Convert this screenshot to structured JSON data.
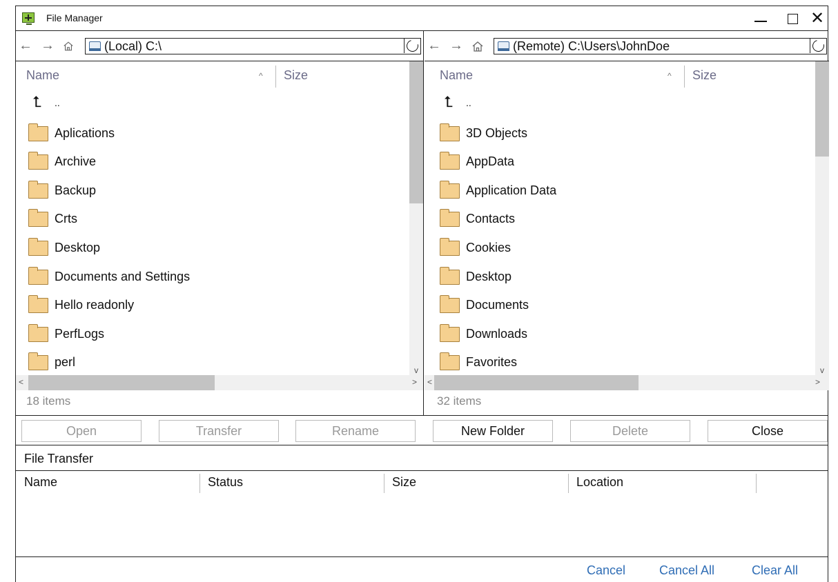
{
  "window": {
    "title": "File Manager",
    "controls": {
      "minimize": "minimize",
      "maximize": "maximize",
      "close": "✕"
    }
  },
  "local": {
    "path": "(Local) C:\\",
    "columns": {
      "name": "Name",
      "size": "Size"
    },
    "parent": "..",
    "items": [
      "Aplications",
      "Archive",
      "Backup",
      "Crts",
      "Desktop",
      "Documents and Settings",
      "Hello readonly",
      "PerfLogs",
      "perl"
    ],
    "status": "18 items"
  },
  "remote": {
    "path": "(Remote) C:\\Users\\JohnDoe",
    "columns": {
      "name": "Name",
      "size": "Size"
    },
    "parent": "..",
    "items": [
      "3D Objects",
      "AppData",
      "Application Data",
      "Contacts",
      "Cookies",
      "Desktop",
      "Documents",
      "Downloads",
      "Favorites"
    ],
    "status": "32 items"
  },
  "actions": {
    "open": "Open",
    "transfer": "Transfer",
    "rename": "Rename",
    "new_folder": "New Folder",
    "delete": "Delete",
    "close": "Close"
  },
  "transfer": {
    "title": "File Transfer",
    "columns": {
      "name": "Name",
      "status": "Status",
      "size": "Size",
      "location": "Location"
    },
    "cancel": "Cancel",
    "cancel_all": "Cancel All",
    "clear_all": "Clear All"
  },
  "colors": {
    "folder": "#f5d08f",
    "link": "#2f6db5",
    "app_icon": "#8dc63f"
  }
}
